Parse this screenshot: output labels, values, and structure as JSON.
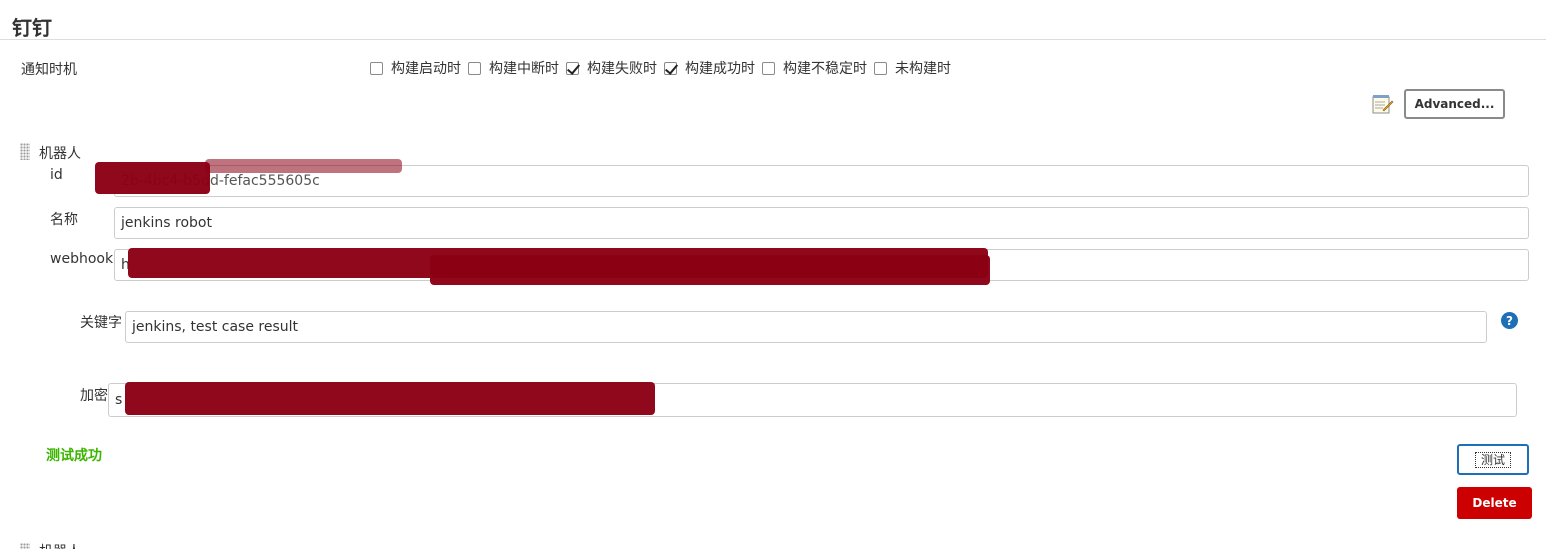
{
  "section": {
    "title": "钉钉"
  },
  "notify": {
    "label": "通知时机",
    "options": [
      {
        "label": "构建启动时",
        "checked": false
      },
      {
        "label": "构建中断时",
        "checked": false
      },
      {
        "label": "构建失败时",
        "checked": true
      },
      {
        "label": "构建成功时",
        "checked": true
      },
      {
        "label": "构建不稳定时",
        "checked": false
      },
      {
        "label": "未构建时",
        "checked": false
      }
    ]
  },
  "advanced_button": "Advanced...",
  "robot": {
    "heading": "机器人",
    "id_label": "id",
    "id_value": "2b-4bc4-b5dd-fefac555605c",
    "name_label": "名称",
    "name_value": "jenkins robot",
    "webhook_label": "webhook",
    "webhook_value": "h",
    "keyword_label": "关键字",
    "keyword_value": "jenkins, test case result",
    "secret_label": "加密",
    "secret_value": "s"
  },
  "help_glyph": "?",
  "test_status": "测试成功",
  "test_button": "测试",
  "delete_button": "Delete",
  "next_robot_label": "机器人"
}
